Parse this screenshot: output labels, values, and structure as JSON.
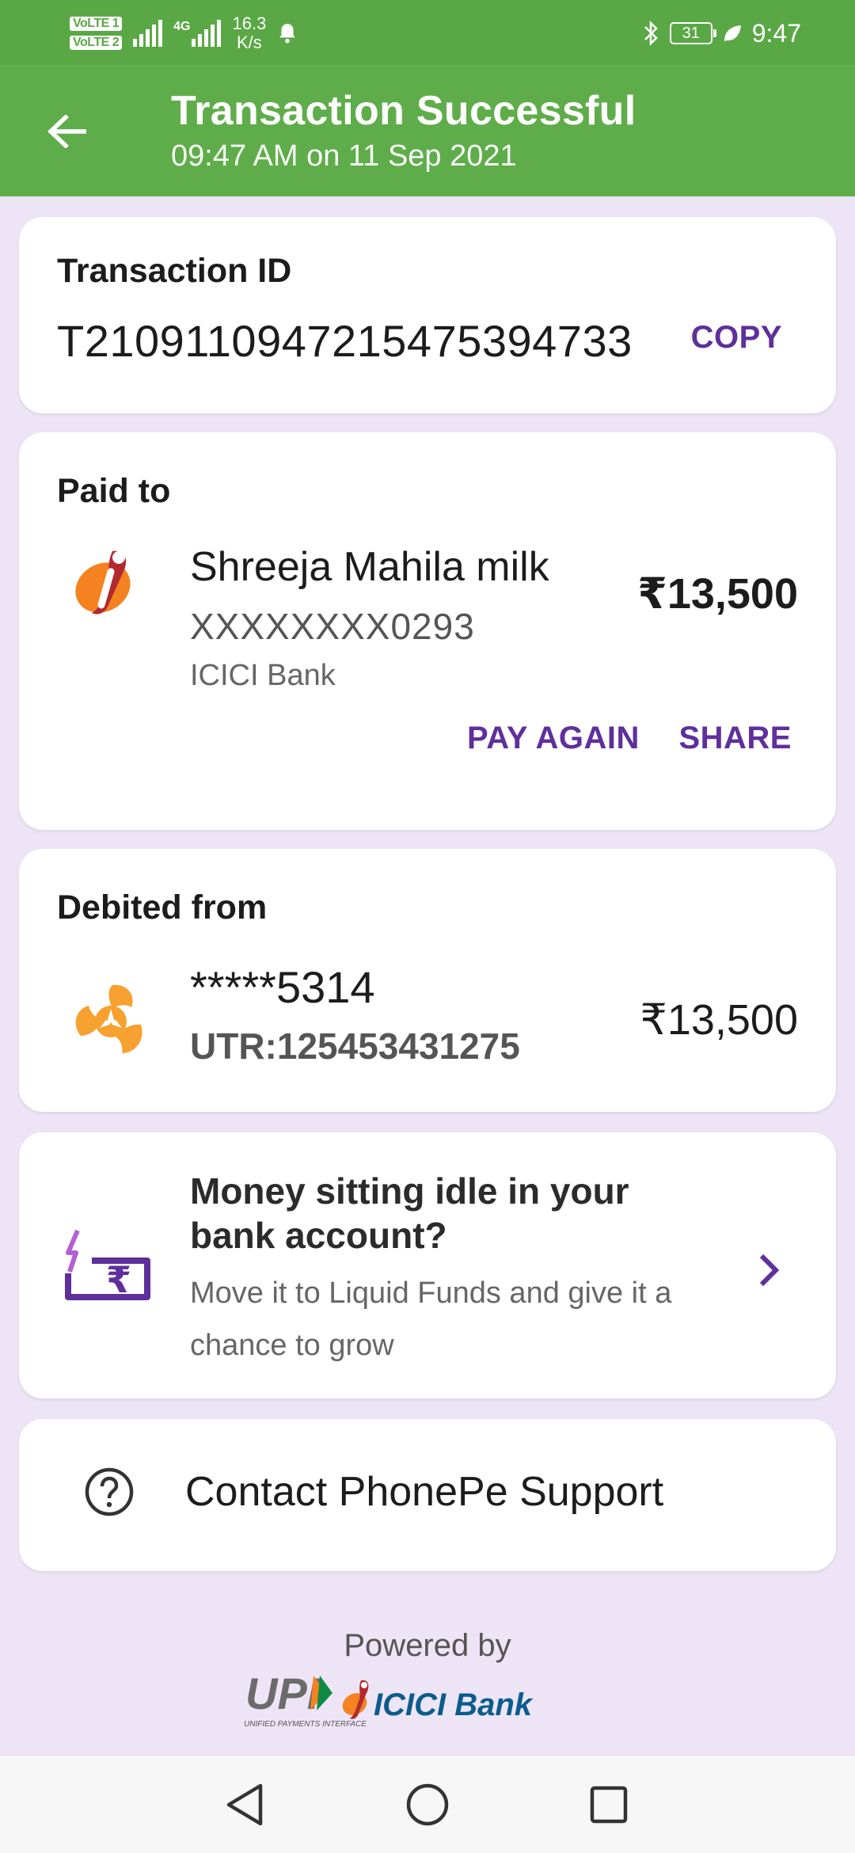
{
  "status_bar": {
    "sim1": "VoLTE 1",
    "sim2": "VoLTE 2",
    "network": "4G",
    "speed_value": "16.3",
    "speed_unit": "K/s",
    "battery": "31",
    "time": "9:47"
  },
  "header": {
    "title": "Transaction Successful",
    "subtitle": "09:47 AM on 11 Sep 2021"
  },
  "transaction": {
    "label": "Transaction ID",
    "id": "T2109110947215475394733",
    "copy_label": "COPY"
  },
  "paid_to": {
    "label": "Paid to",
    "name": "Shreeja Mahila milk",
    "account": "XXXXXXXX0293",
    "bank": "ICICI Bank",
    "amount": "₹13,500",
    "pay_again_label": "PAY AGAIN",
    "share_label": "SHARE"
  },
  "debited_from": {
    "label": "Debited from",
    "account": "*****5314",
    "utr": "UTR:125453431275",
    "amount": "₹13,500"
  },
  "promo": {
    "title": "Money sitting idle in your bank account?",
    "text": "Move it to Liquid Funds and give it a chance to grow"
  },
  "support": {
    "label": "Contact PhonePe Support"
  },
  "footer": {
    "powered_by": "Powered by",
    "upi_logo_text": "UPI",
    "upi_tagline": "UNIFIED PAYMENTS INTERFACE",
    "bank_logo_text": "ICICI Bank"
  },
  "colors": {
    "header_green": "#5fad4a",
    "accent_purple": "#5f2f9c",
    "background": "#ede5f6"
  }
}
